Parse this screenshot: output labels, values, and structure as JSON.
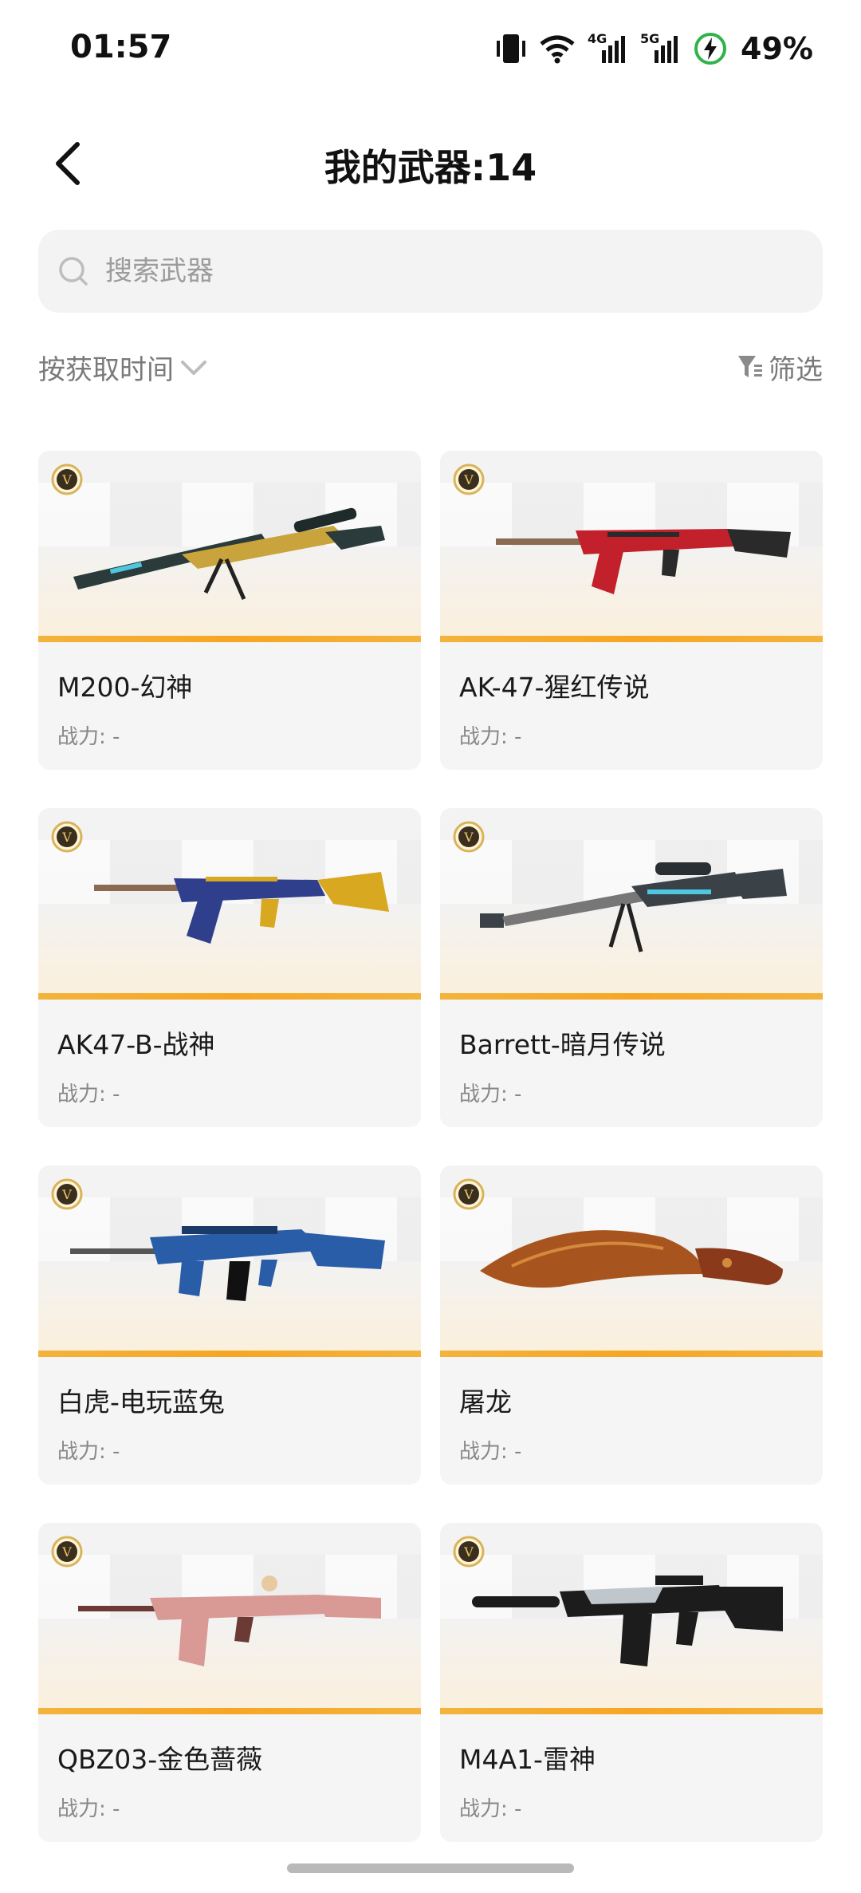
{
  "status_bar": {
    "time": "01:57",
    "network_4g": "4G",
    "network_5g": "5G",
    "battery": "49%",
    "icons": [
      "vibrate-icon",
      "wifi-icon",
      "signal-4g-icon",
      "signal-5g-icon",
      "battery-charging-icon"
    ]
  },
  "header": {
    "back_icon": "chevron-left-icon",
    "title": "我的武器:14"
  },
  "search": {
    "placeholder": "搜索武器",
    "value": ""
  },
  "controls": {
    "sort_label": "按获取时间",
    "filter_label": "筛选"
  },
  "colors": {
    "accent": "#f6a623",
    "card_bg": "#f5f5f5",
    "badge_gold": "#d8b35a"
  },
  "weapons": [
    {
      "name": "M200-幻神",
      "power": "战力: -",
      "badge": "V",
      "art": "sniper-dark-gold",
      "color": "#2b3a3a",
      "accent": "#c9a33b"
    },
    {
      "name": "AK-47-猩红传说",
      "power": "战力: -",
      "badge": "V",
      "art": "ak-red",
      "color": "#c2202a",
      "accent": "#2a2a2a"
    },
    {
      "name": "AK47-B-战神",
      "power": "战力: -",
      "badge": "V",
      "art": "ak-blue-gold",
      "color": "#2f3f8c",
      "accent": "#d8a820"
    },
    {
      "name": "Barrett-暗月传说",
      "power": "战力: -",
      "badge": "V",
      "art": "barrett-cyan",
      "color": "#3a4248",
      "accent": "#4fc6e0"
    },
    {
      "name": "白虎-电玩蓝兔",
      "power": "战力: -",
      "badge": "V",
      "art": "rifle-blue",
      "color": "#2a5da8",
      "accent": "#111"
    },
    {
      "name": "屠龙",
      "power": "战力: -",
      "badge": "V",
      "art": "machete-bronze",
      "color": "#a8541f",
      "accent": "#d48a3c"
    },
    {
      "name": "QBZ03-金色蔷薇",
      "power": "战力: -",
      "badge": "V",
      "art": "rifle-pink",
      "color": "#d99a96",
      "accent": "#6b3a35"
    },
    {
      "name": "M4A1-雷神",
      "power": "战力: -",
      "badge": "V",
      "art": "m4-black",
      "color": "#1c1c1c",
      "accent": "#bfc6cc"
    }
  ]
}
